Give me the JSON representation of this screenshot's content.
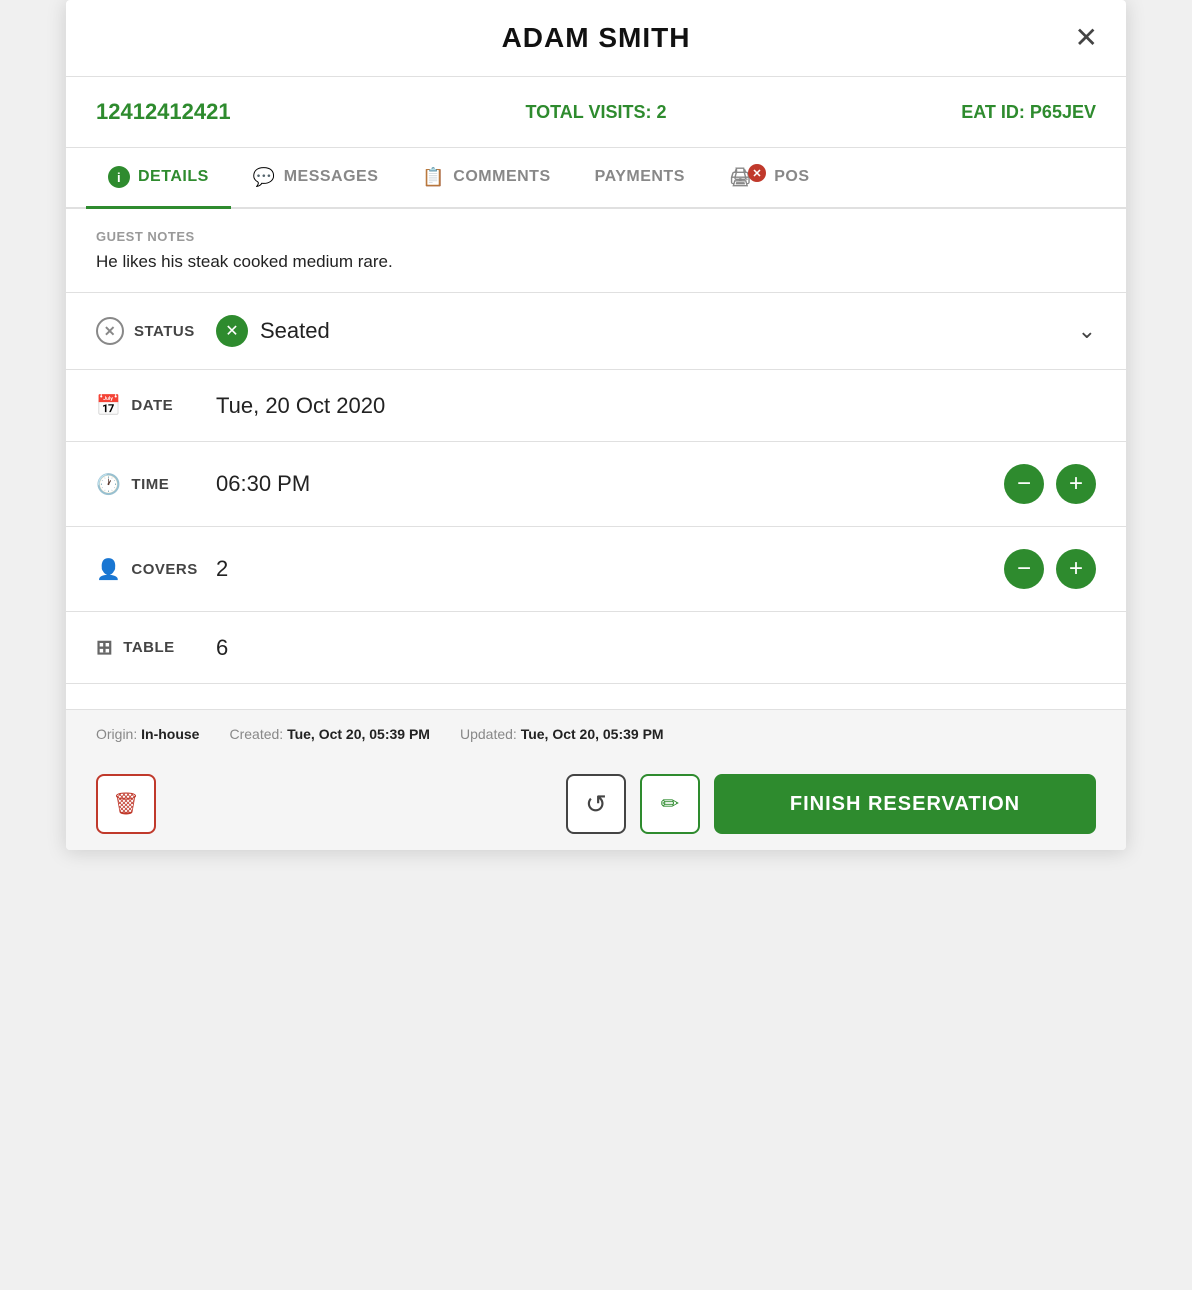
{
  "header": {
    "title": "ADAM SMITH",
    "close_label": "✕"
  },
  "info": {
    "phone": "12412412421",
    "total_visits_label": "TOTAL VISITS:",
    "total_visits_value": "2",
    "eat_id_label": "EAT ID:",
    "eat_id_value": "P65JEV"
  },
  "tabs": [
    {
      "id": "details",
      "label": "DETAILS",
      "icon": "ℹ",
      "active": true
    },
    {
      "id": "messages",
      "label": "MESSAGES",
      "icon": "💬",
      "active": false
    },
    {
      "id": "comments",
      "label": "COMMENTS",
      "icon": "📋",
      "active": false
    },
    {
      "id": "payments",
      "label": "PAYMENTS",
      "icon": "",
      "active": false
    },
    {
      "id": "pos",
      "label": "POS",
      "icon": "",
      "active": false
    }
  ],
  "guest_notes": {
    "label": "GUEST NOTES",
    "text": "He likes his steak cooked medium rare."
  },
  "details": {
    "status": {
      "label": "STATUS",
      "value": "Seated"
    },
    "date": {
      "label": "DATE",
      "value": "Tue, 20 Oct 2020"
    },
    "time": {
      "label": "TIME",
      "value": "06:30 PM"
    },
    "covers": {
      "label": "COVERS",
      "value": "2"
    },
    "table": {
      "label": "TABLE",
      "value": "6"
    }
  },
  "footer": {
    "origin_label": "Origin:",
    "origin_value": "In-house",
    "created_label": "Created:",
    "created_value": "Tue, Oct 20, 05:39 PM",
    "updated_label": "Updated:",
    "updated_value": "Tue, Oct 20, 05:39 PM"
  },
  "actions": {
    "delete_icon": "🗑",
    "history_icon": "↺",
    "edit_icon": "✏",
    "finish_label": "FINISH RESERVATION"
  }
}
